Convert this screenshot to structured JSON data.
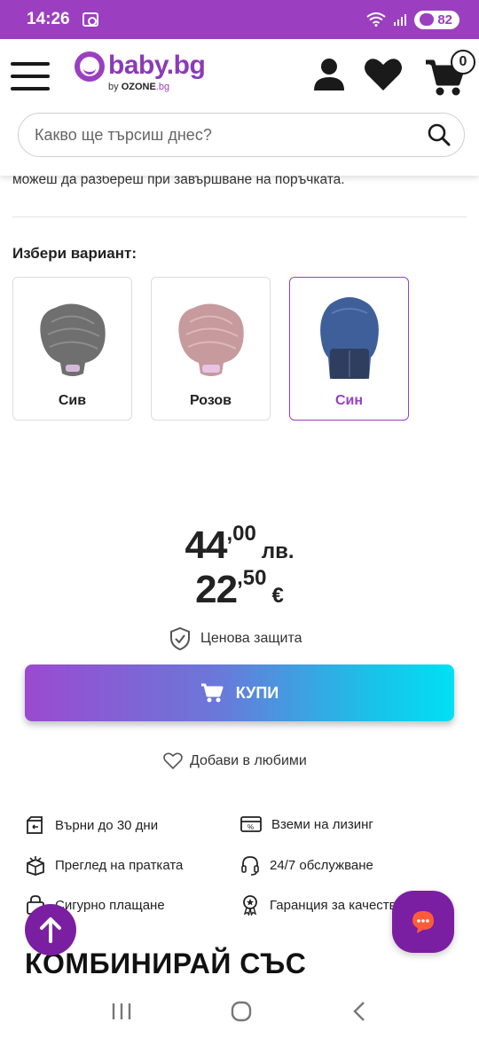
{
  "status_bar": {
    "time": "14:26",
    "battery": "82"
  },
  "header": {
    "logo_main": "baby.bg",
    "logo_by": "by",
    "logo_ozone": "OZONE",
    "logo_ozone_suffix": ".bg",
    "cart_count": "0",
    "search_placeholder": "Какво ще търсиш днес?"
  },
  "product": {
    "partial_note": "можеш да разбереш при завършване на поръчката.",
    "variant_title": "Избери вариант:",
    "variants": [
      {
        "label": "Сив",
        "color": "#6f6f6f",
        "selected": false
      },
      {
        "label": "Розов",
        "color": "#c79a9e",
        "selected": false
      },
      {
        "label": "Син",
        "color": "#3f5f9b",
        "selected": true
      }
    ],
    "price_bgn": {
      "int": "44",
      "dec": ",00",
      "currency": "лв."
    },
    "price_eur": {
      "int": "22",
      "dec": ",50",
      "currency": "€"
    },
    "price_protection": "Ценова защита",
    "buy_label": "КУПИ",
    "add_favorite": "Добави в любими"
  },
  "features": [
    {
      "icon": "return-box-icon",
      "label": "Върни до 30 дни"
    },
    {
      "icon": "leasing-card-icon",
      "label": "Вземи на лизинг"
    },
    {
      "icon": "open-box-icon",
      "label": "Преглед на пратката"
    },
    {
      "icon": "headset-icon",
      "label": "24/7 обслужване"
    },
    {
      "icon": "secure-payment-icon",
      "label": "Сигурно плащане"
    },
    {
      "icon": "award-icon",
      "label": "Гаранция за качество"
    }
  ],
  "section_title": "КОМБИНИРАЙ СЪС",
  "colors": {
    "brand_purple": "#9b3fc0",
    "fab_purple": "#7b1fa2",
    "gradient_start": "#9b4ad0",
    "gradient_end": "#00e0f5"
  }
}
